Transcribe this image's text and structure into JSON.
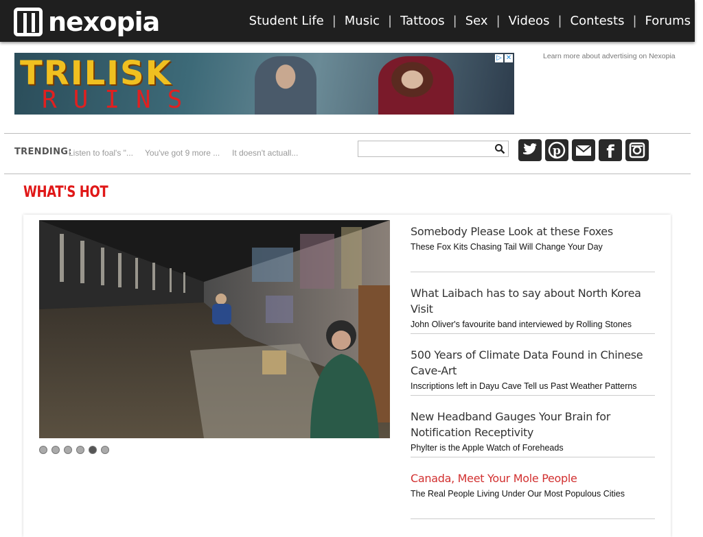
{
  "header": {
    "logo_text": "nexopia",
    "nav": [
      "Student Life",
      "Music",
      "Tattoos",
      "Sex",
      "Videos",
      "Contests",
      "Forums"
    ],
    "nav_separator": "|"
  },
  "ad": {
    "title": "TRILISK",
    "subtitle": "RUINS",
    "learn_more": "Learn more about advertising on Nexopia",
    "corner_icons": [
      "adchoices-icon",
      "close-icon"
    ]
  },
  "trending": {
    "label": "TRENDING:",
    "items": [
      "Listen to foal's \"...",
      "You've got 9 more ...",
      "It doesn't actuall..."
    ]
  },
  "search": {
    "placeholder": "",
    "value": ""
  },
  "social": [
    "twitter-icon",
    "pinterest-icon",
    "email-icon",
    "facebook-icon",
    "instagram-icon"
  ],
  "section_title": "WHAT'S HOT",
  "slider": {
    "count": 6,
    "active": 5
  },
  "stories": [
    {
      "title": "Somebody Please Look at these Foxes",
      "sub": "These Fox Kits Chasing Tail Will Change Your Day"
    },
    {
      "title": "What Laibach has to say about North Korea Visit",
      "sub": "John Oliver's favourite band interviewed by Rolling Stones"
    },
    {
      "title": "500 Years of Climate Data Found in Chinese Cave-Art",
      "sub": "Inscriptions left in Dayu Cave Tell us Past Weather Patterns"
    },
    {
      "title": "New Headband Gauges Your Brain for Notification Receptivity",
      "sub": "Phylter is the Apple Watch of Foreheads"
    },
    {
      "title": "Canada, Meet Your Mole People",
      "sub": "The Real People Living Under Our Most Populous Cities"
    }
  ],
  "colors": {
    "accent_red": "#e01818",
    "highlight_story": "#d23030",
    "topbar": "#1f1f1f"
  }
}
